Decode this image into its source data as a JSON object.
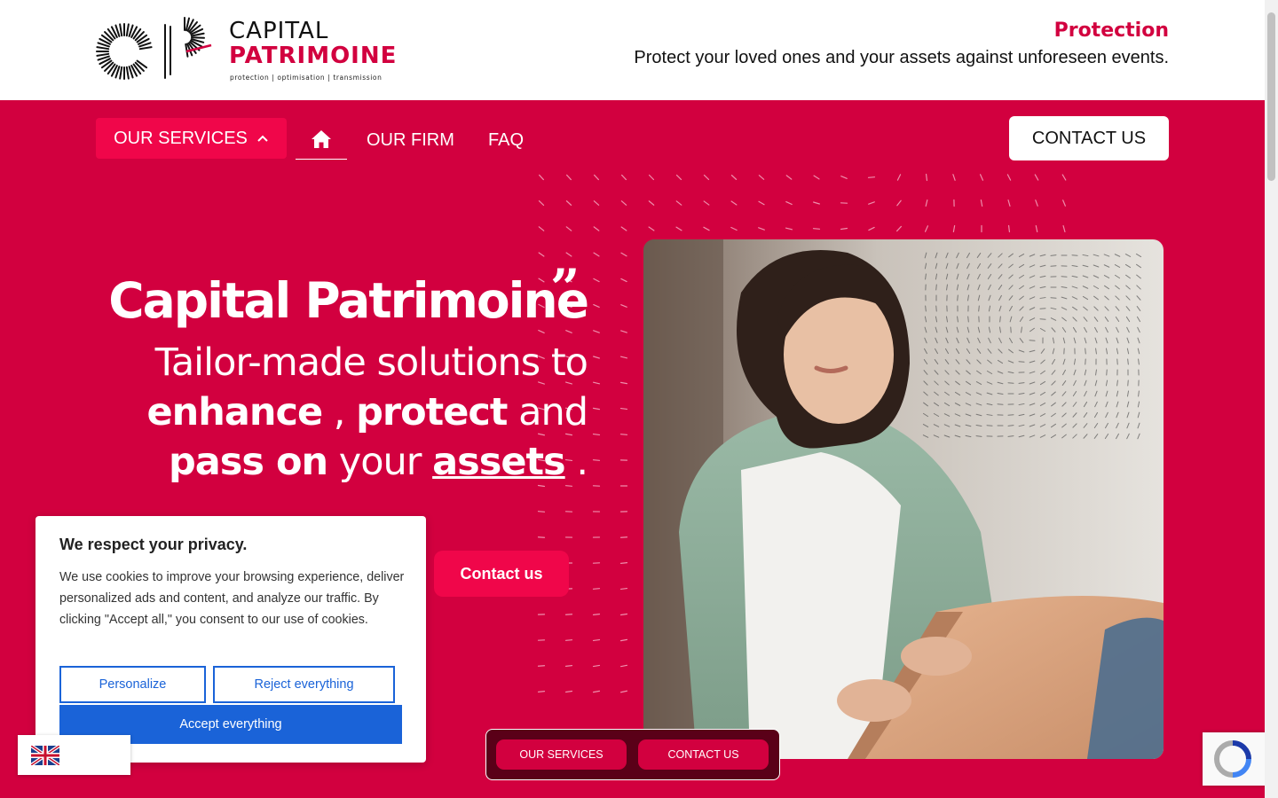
{
  "brand": {
    "name_line1": "CAPITAL",
    "name_line2": "PATRIMOINE",
    "tagline": "protection | optimisation | transmission",
    "accent_color": "#d2003f"
  },
  "header": {
    "section_title": "Protection",
    "section_subtitle": "Protect your loved ones and your assets against unforeseen events."
  },
  "nav": {
    "services_label": "OUR SERVICES",
    "services_icon": "chevron-up-icon",
    "home_icon": "home-icon",
    "firm_label": "OUR FIRM",
    "faq_label": "FAQ",
    "contact_label": "CONTACT US"
  },
  "hero": {
    "quote_mark": "”",
    "title": "Capital Patrimoine",
    "line1": "Tailor-made solutions to",
    "word_enhance": "enhance",
    "comma": " , ",
    "word_protect": "protect",
    "word_and": " and",
    "word_pass": "pass on",
    "word_your": " your ",
    "word_assets": "assets",
    "period": " .",
    "cta_label": "Contact us"
  },
  "cookie_banner": {
    "title": "We respect your privacy.",
    "body": "We use cookies to improve your browsing experience, deliver personalized ads and content, and analyze our traffic. By clicking \"Accept all,\" you consent to our use of cookies.",
    "personalize_label": "Personalize",
    "reject_label": "Reject everything",
    "accept_label": "Accept everything",
    "button_color": "#1a63d8"
  },
  "language_switcher": {
    "flag_icon": "uk-flag-icon"
  },
  "sticky_bar": {
    "services_label": "OUR SERVICES",
    "contact_label": "CONTACT US"
  },
  "recaptcha": {
    "icon": "recaptcha-icon"
  }
}
